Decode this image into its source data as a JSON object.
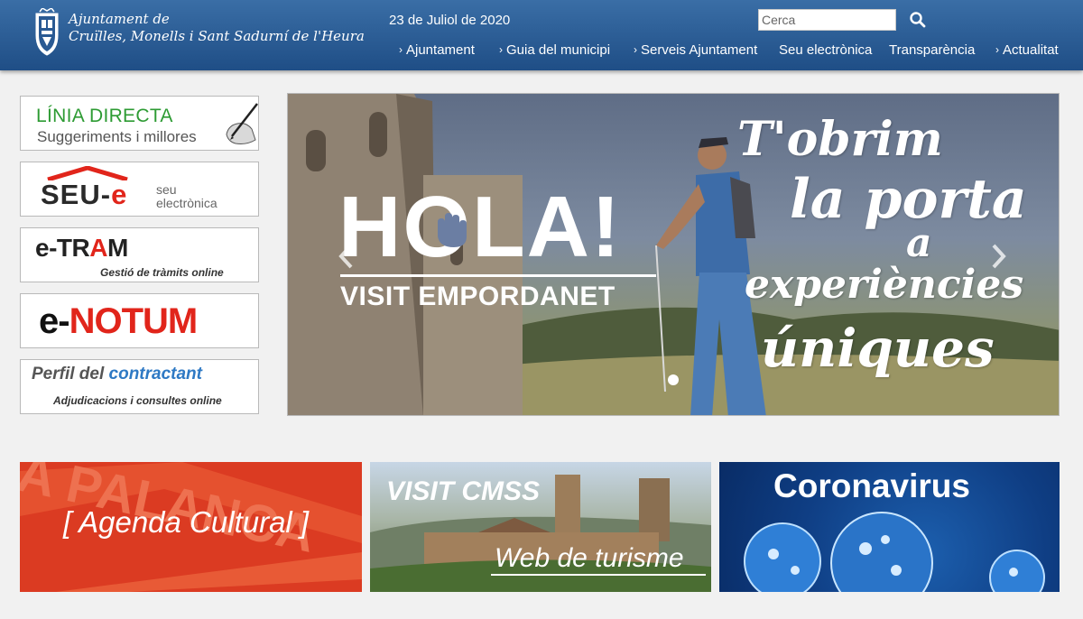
{
  "header": {
    "site_name_line1": "Ajuntament de",
    "site_name_line2": "Cruïlles, Monells i Sant Sadurní de l'Heura",
    "date": "23 de Juliol de 2020",
    "search_placeholder": "Cerca",
    "search_icon": "search-icon"
  },
  "nav": {
    "items": [
      {
        "label": "Ajuntament",
        "chevron": true
      },
      {
        "label": "Guia del municipi",
        "chevron": true
      },
      {
        "label": "Serveis Ajuntament",
        "chevron": true
      },
      {
        "label": "Seu electrònica",
        "chevron": false
      },
      {
        "label": "Transparència",
        "chevron": false
      },
      {
        "label": "Actualitat",
        "chevron": true
      }
    ],
    "chevron_glyph": "›"
  },
  "side_buttons": {
    "linia_directa": {
      "title": "LÍNIA DIRECTA",
      "subtitle": "Suggeriments i millores"
    },
    "seu_e": {
      "mark_main": "SEU-",
      "mark_red": "e",
      "sub_line1": "seu",
      "sub_line2": "electrònica"
    },
    "e_tram": {
      "mark_main": "e-TR",
      "mark_red": "A",
      "mark_end": "M",
      "subtitle": "Gestió de tràmits online"
    },
    "e_notum": {
      "mark_main": "e-",
      "mark_red": "NOTUM"
    },
    "perfil": {
      "title_a": "Perfil del ",
      "title_b": "contractant",
      "subtitle": "Adjudicacions i consultes online"
    }
  },
  "carousel": {
    "hola": "HOLA!",
    "visit": "VISIT EMPORDANET",
    "script_lines": [
      "T'obrim",
      "la porta",
      "a",
      "experiències",
      "úniques"
    ],
    "prev_icon": "chevron-left-icon",
    "next_icon": "chevron-right-icon"
  },
  "banners": {
    "agenda": "[ Agenda Cultural ]",
    "agenda_bg_text": "A PALANCA",
    "visit_cmss": "VISIT CMSS",
    "web_turisme": "Web de turisme",
    "coronavirus": "Coronavirus"
  },
  "colors": {
    "header_top": "#3a6ea6",
    "header_bottom": "#1f4e86",
    "green": "#2d9b33",
    "red": "#e1251b",
    "blue": "#2e79c4",
    "agenda_bg": "#db3b22",
    "corona_bg": "#0f3e84"
  }
}
